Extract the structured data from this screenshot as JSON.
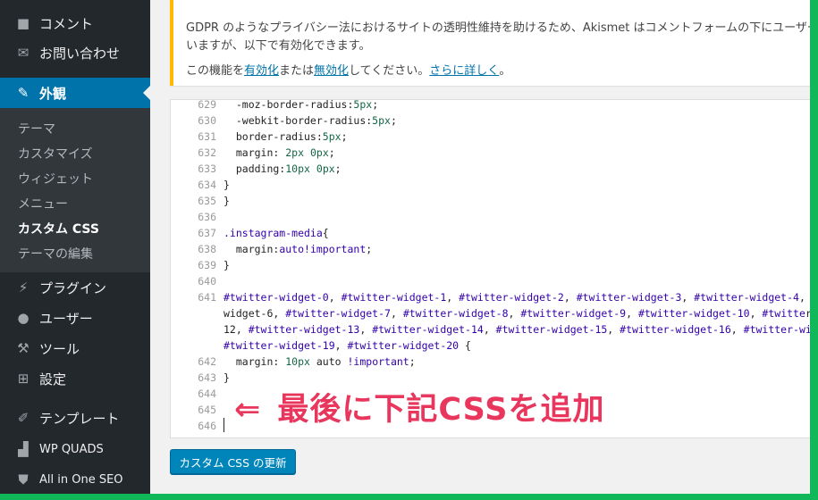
{
  "sidebar": {
    "menu": [
      {
        "label": "コメント",
        "icon": "comment-icon",
        "glyph": "■"
      },
      {
        "label": "お問い合わせ",
        "icon": "mail-icon",
        "glyph": "✉"
      },
      {
        "label": "外観",
        "icon": "paintbrush-icon",
        "glyph": "✎"
      },
      {
        "label": "プラグイン",
        "icon": "plugin-icon",
        "glyph": "⚡"
      },
      {
        "label": "ユーザー",
        "icon": "user-icon",
        "glyph": "●"
      },
      {
        "label": "ツール",
        "icon": "wrench-icon",
        "glyph": "⚒"
      },
      {
        "label": "設定",
        "icon": "settings-icon",
        "glyph": "⊞"
      },
      {
        "label": "テンプレート",
        "icon": "pen-icon",
        "glyph": "✐"
      },
      {
        "label": "WP QUADS",
        "icon": "bar-chart-icon",
        "glyph": "▟"
      },
      {
        "label": "All in One SEO",
        "icon": "shield-icon",
        "glyph": "⛊"
      }
    ],
    "submenu": [
      "テーマ",
      "カスタマイズ",
      "ウィジェット",
      "メニュー",
      "カスタム CSS",
      "テーマの編集"
    ]
  },
  "notice": {
    "line1": "GDPR のようなプライバシー法におけるサイトの透明性維持を助けるため、Akismet はコメントフォームの下にユーザー",
    "line2": "いますが、以下で有効化できます。",
    "line3_pre": "この機能を",
    "link_enable": "有効化",
    "line3_mid": "または",
    "link_disable": "無効化",
    "line3_post": "してください。",
    "link_more": "さらに詳しく",
    "line3_end": "。"
  },
  "editor": {
    "line_numbers": [
      "629",
      "630",
      "631",
      "632",
      "633",
      "634",
      "635",
      "636",
      "637",
      "638",
      "639",
      "640",
      "641",
      "",
      "",
      "",
      "642",
      "643",
      "644",
      "645",
      "646"
    ],
    "lines": [
      "  -moz-border-radius:5px;",
      "  -webkit-border-radius:5px;",
      "  border-radius:5px;",
      "  margin: 2px 0px;",
      "  padding:10px 0px;",
      "}",
      "}",
      "",
      ".instagram-media{",
      "  margin:auto!important;",
      "}",
      "",
      "#twitter-widget-0, #twitter-widget-1, #twitter-widget-2, #twitter-widget-3, #twitter-widget-4, #twitte",
      "widget-6, #twitter-widget-7, #twitter-widget-8, #twitter-widget-9, #twitter-widget-10, #twitter-widge",
      "12, #twitter-widget-13, #twitter-widget-14, #twitter-widget-15, #twitter-widget-16, #twitter-widget-1",
      "#twitter-widget-19, #twitter-widget-20 {",
      "  margin: 10px auto !important;",
      "}",
      "",
      "",
      ""
    ]
  },
  "callout": {
    "arrow": "⇐",
    "text": "最後に下記CSSを追加"
  },
  "update_button": "カスタム CSS の更新",
  "colors": {
    "accent": "#0073aa",
    "callout": "#e8365d",
    "notice_border": "#ffb900",
    "frame": "#11b85a"
  }
}
